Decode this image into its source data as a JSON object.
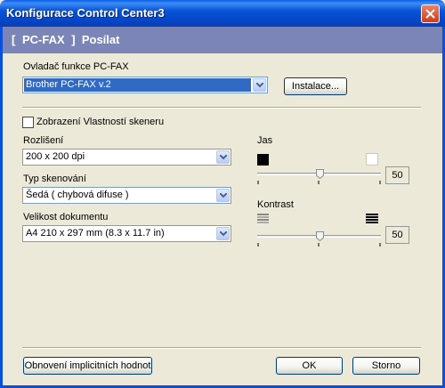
{
  "window": {
    "title": "Konfigurace Control Center3"
  },
  "header": {
    "section": "PC-FAX",
    "subsection": "Posílat",
    "open_bracket": "[",
    "close_bracket": "]"
  },
  "driver": {
    "label": "Ovladač funkce PC-FAX",
    "selected": "Brother PC-FAX v.2",
    "install_label": "Instalace..."
  },
  "scanner_props": {
    "label": "Zobrazení Vlastností skeneru",
    "checked": false
  },
  "resolution": {
    "label": "Rozlišení",
    "selected": "200 x 200 dpi"
  },
  "scan_type": {
    "label": "Typ skenování",
    "selected": "Šedá ( chybová difuse )"
  },
  "doc_size": {
    "label": "Velikost dokumentu",
    "selected": "A4 210 x 297 mm (8.3 x 11.7 in)"
  },
  "brightness": {
    "label": "Jas",
    "value": "50",
    "level": 0.5
  },
  "contrast": {
    "label": "Kontrast",
    "value": "50",
    "level": 0.5
  },
  "footer": {
    "restore_label": "Obnovení implicitních hodnot",
    "ok_label": "OK",
    "cancel_label": "Storno"
  },
  "colors": {
    "title_bar": "#0a5fe6",
    "header_band": "#7b85b8",
    "selection": "#316ac5",
    "dialog_bg": "#ece9d8"
  },
  "icons": [
    "close-icon",
    "dropdown-arrow-icon",
    "dark-square-icon",
    "light-square-icon",
    "low-contrast-icon",
    "high-contrast-icon"
  ]
}
